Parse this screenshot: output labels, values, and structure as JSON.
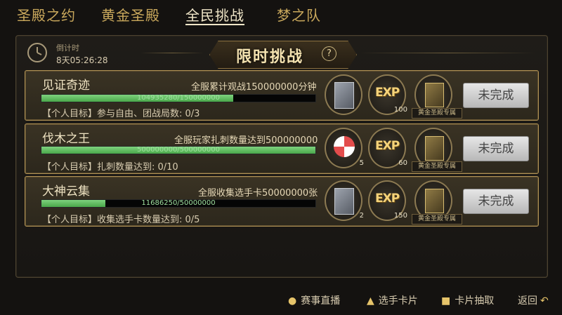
{
  "tabs": [
    "圣殿之约",
    "黄金圣殿",
    "全民挑战",
    "梦之队"
  ],
  "countdown": {
    "label": "倒计时",
    "value": "8天05:26:28"
  },
  "title": "限时挑战",
  "help_symbol": "?",
  "challenges": [
    {
      "name": "见证奇迹",
      "goal": "全服累计观战150000000分钟",
      "progress_text": "104935280/150000000",
      "progress": 0.6996,
      "personal": "【个人目标】参与自由、团战局数: 0/3",
      "rewards": [
        {
          "icon": "silver-card-icon",
          "count": ""
        },
        {
          "icon": "exp-icon",
          "count": "100"
        },
        {
          "icon": "gold-card-icon",
          "tag": "黄金圣殿专属"
        }
      ],
      "button": "未完成"
    },
    {
      "name": "伐木之王",
      "goal": "全服玩家扎刺数量达到500000000",
      "progress_text": "500000000/500000000",
      "progress": 1.0,
      "personal": "【个人目标】扎刺数量达到: 0/10",
      "rewards": [
        {
          "icon": "candy-icon",
          "count": "5"
        },
        {
          "icon": "exp-icon",
          "count": "60"
        },
        {
          "icon": "gold-card-icon",
          "tag": "黄金圣殿专属"
        }
      ],
      "button": "未完成"
    },
    {
      "name": "大神云集",
      "goal": "全服收集选手卡50000000张",
      "progress_text": "11686250/50000000",
      "progress": 0.2337,
      "personal": "【个人目标】收集选手卡数量达到: 0/5",
      "rewards": [
        {
          "icon": "silver-card-icon",
          "count": "2"
        },
        {
          "icon": "exp-icon",
          "count": "150"
        },
        {
          "icon": "gold-card-icon",
          "tag": "黄金圣殿专属"
        }
      ],
      "button": "未完成"
    }
  ],
  "bottom": {
    "live": "赛事直播",
    "cards": "选手卡片",
    "draw": "卡片抽取",
    "back": "返回"
  }
}
